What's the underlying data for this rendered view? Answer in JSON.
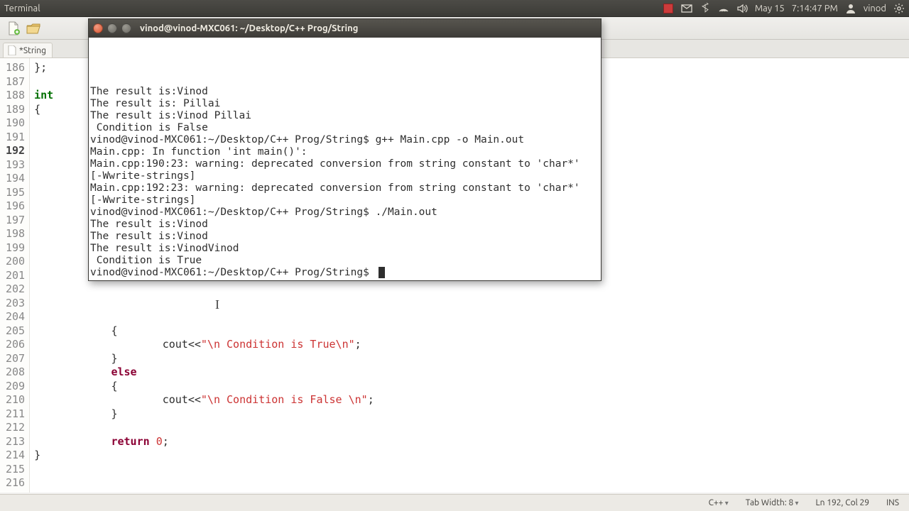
{
  "panel": {
    "app_title": "Terminal",
    "date": "May 15",
    "time": "7:14:47 PM",
    "user": "vinod"
  },
  "editor": {
    "tab_label": "*String",
    "lines": [
      {
        "n": "186",
        "frag": [
          {
            "t": "};",
            "c": ""
          }
        ]
      },
      {
        "n": "187",
        "frag": []
      },
      {
        "n": "188",
        "frag": [
          {
            "t": "int",
            "c": "typ"
          }
        ]
      },
      {
        "n": "189",
        "frag": [
          {
            "t": "{",
            "c": ""
          }
        ]
      },
      {
        "n": "190",
        "frag": []
      },
      {
        "n": "191",
        "frag": []
      },
      {
        "n": "192",
        "frag": [],
        "current": true
      },
      {
        "n": "193",
        "frag": []
      },
      {
        "n": "194",
        "frag": []
      },
      {
        "n": "195",
        "frag": []
      },
      {
        "n": "196",
        "frag": []
      },
      {
        "n": "197",
        "frag": []
      },
      {
        "n": "198",
        "frag": []
      },
      {
        "n": "199",
        "frag": []
      },
      {
        "n": "200",
        "frag": []
      },
      {
        "n": "201",
        "frag": []
      },
      {
        "n": "202",
        "frag": []
      },
      {
        "n": "203",
        "frag": []
      },
      {
        "n": "204",
        "frag": []
      },
      {
        "n": "205",
        "frag": [
          {
            "t": "            {",
            "c": ""
          }
        ]
      },
      {
        "n": "206",
        "frag": [
          {
            "t": "                    cout<<",
            "c": ""
          },
          {
            "t": "\"\\n Condition is True\\n\"",
            "c": "str"
          },
          {
            "t": ";",
            "c": ""
          }
        ]
      },
      {
        "n": "207",
        "frag": [
          {
            "t": "            }",
            "c": ""
          }
        ]
      },
      {
        "n": "208",
        "frag": [
          {
            "t": "            ",
            "c": ""
          },
          {
            "t": "else",
            "c": "kw"
          }
        ]
      },
      {
        "n": "209",
        "frag": [
          {
            "t": "            {",
            "c": ""
          }
        ]
      },
      {
        "n": "210",
        "frag": [
          {
            "t": "                    cout<<",
            "c": ""
          },
          {
            "t": "\"\\n Condition is False \\n\"",
            "c": "str"
          },
          {
            "t": ";",
            "c": ""
          }
        ]
      },
      {
        "n": "211",
        "frag": [
          {
            "t": "            }",
            "c": ""
          }
        ]
      },
      {
        "n": "212",
        "frag": []
      },
      {
        "n": "213",
        "frag": [
          {
            "t": "            ",
            "c": ""
          },
          {
            "t": "return",
            "c": "kw"
          },
          {
            "t": " ",
            "c": ""
          },
          {
            "t": "0",
            "c": "num"
          },
          {
            "t": ";",
            "c": ""
          }
        ]
      },
      {
        "n": "214",
        "frag": [
          {
            "t": "}",
            "c": ""
          }
        ]
      },
      {
        "n": "215",
        "frag": []
      },
      {
        "n": "216",
        "frag": []
      }
    ]
  },
  "status": {
    "lang": "C++",
    "tab_width": "Tab Width: 8",
    "position": "Ln 192, Col 29",
    "mode": "INS"
  },
  "terminal": {
    "title": "vinod@vinod-MXC061: ~/Desktop/C++ Prog/String",
    "lines": [
      "",
      "The result is:Vinod",
      "",
      "The result is: Pillai",
      "",
      "The result is:Vinod Pillai",
      "",
      " Condition is False",
      "vinod@vinod-MXC061:~/Desktop/C++ Prog/String$ g++ Main.cpp -o Main.out",
      "Main.cpp: In function 'int main()':",
      "Main.cpp:190:23: warning: deprecated conversion from string constant to 'char*'",
      "[-Wwrite-strings]",
      "Main.cpp:192:23: warning: deprecated conversion from string constant to 'char*'",
      "[-Wwrite-strings]",
      "vinod@vinod-MXC061:~/Desktop/C++ Prog/String$ ./Main.out",
      "",
      "The result is:Vinod",
      "",
      "The result is:Vinod",
      "",
      "The result is:VinodVinod",
      "",
      " Condition is True",
      "vinod@vinod-MXC061:~/Desktop/C++ Prog/String$ "
    ]
  }
}
